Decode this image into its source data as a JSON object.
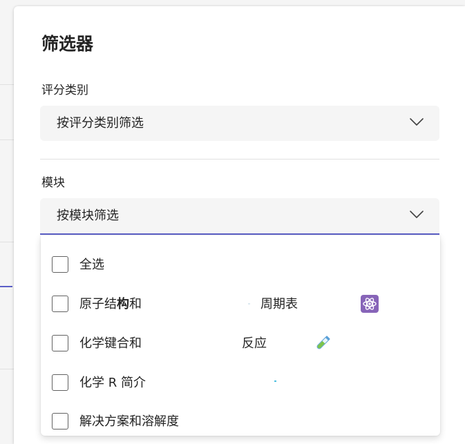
{
  "panel": {
    "title": "筛选器"
  },
  "grading_category": {
    "label": "评分类别",
    "placeholder": "按评分类别筛选"
  },
  "module": {
    "label": "模块",
    "placeholder": "按模块筛选",
    "options": [
      {
        "label": "全选",
        "checked": false
      },
      {
        "label_pre": "原子结",
        "label_bold": "构",
        "label_post": "和",
        "label_extra": "周期表",
        "icon": "atom-icon",
        "checked": false
      },
      {
        "label": "化学键合和",
        "label_extra": "反应",
        "icon": "test-tube-icon",
        "checked": false
      },
      {
        "label": "化学 R 简介",
        "checked": false
      },
      {
        "label": "解决方案和溶解度",
        "checked": false
      }
    ]
  },
  "colors": {
    "accent": "#5b5fc7",
    "atom_icon_bg": "#8764b8",
    "test_tube": "#7cc44a"
  }
}
